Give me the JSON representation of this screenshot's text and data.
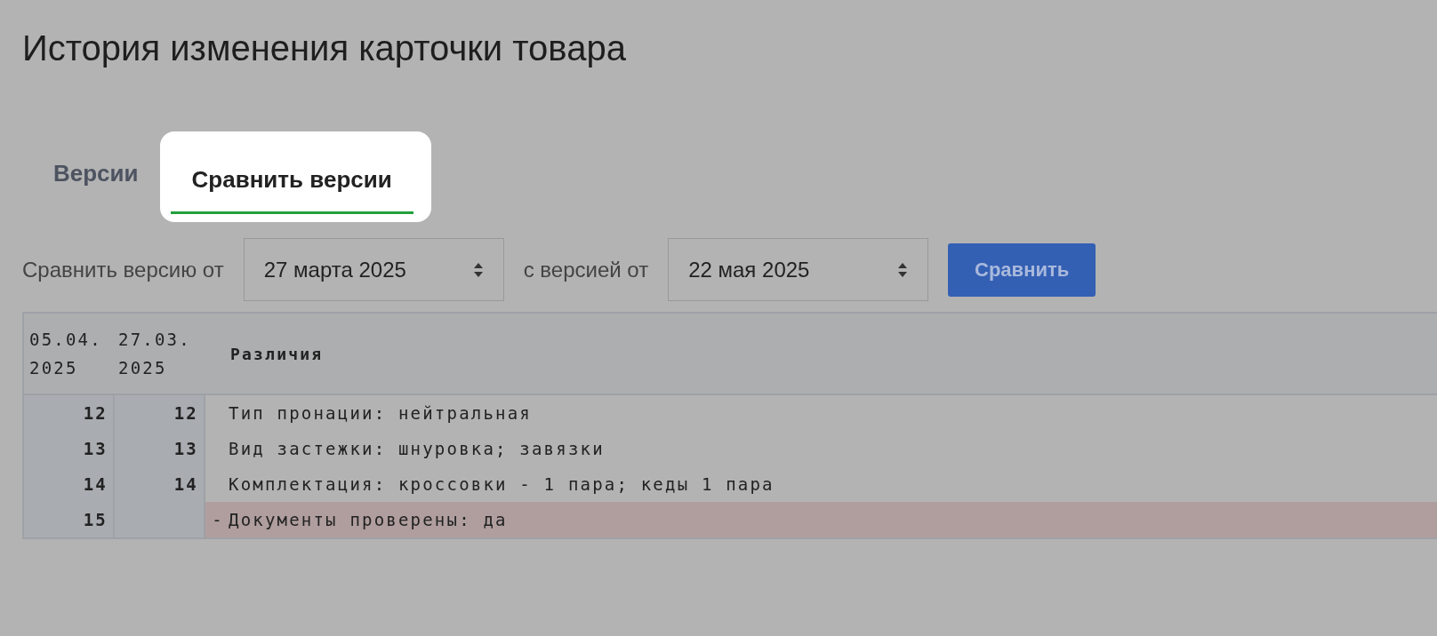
{
  "title": "История изменения карточки товара",
  "tabs": [
    {
      "label": "Версии",
      "selected": false
    },
    {
      "label": "Сравнить версии",
      "selected": true
    }
  ],
  "compare": {
    "from_label": "Сравнить версию от",
    "from_value": "27 марта 2025",
    "to_label": "с версией от",
    "to_value": "22 мая 2025",
    "button": "Сравнить"
  },
  "diff": {
    "columns": [
      "05.04. 2025",
      "27.03. 2025",
      "Различия"
    ],
    "rows": [
      {
        "kind": "context",
        "old": "12",
        "new": "12",
        "text": "Тип пронации: нейтральная"
      },
      {
        "kind": "context",
        "old": "13",
        "new": "13",
        "text": "Вид застежки: шнуровка; завязки"
      },
      {
        "kind": "context",
        "old": "14",
        "new": "14",
        "text": "Комплектация: кроссовки - 1 пара; кеды 1 пара"
      },
      {
        "kind": "removed",
        "old": "15",
        "marker": "-",
        "text": "Документы проверены: да"
      }
    ]
  }
}
